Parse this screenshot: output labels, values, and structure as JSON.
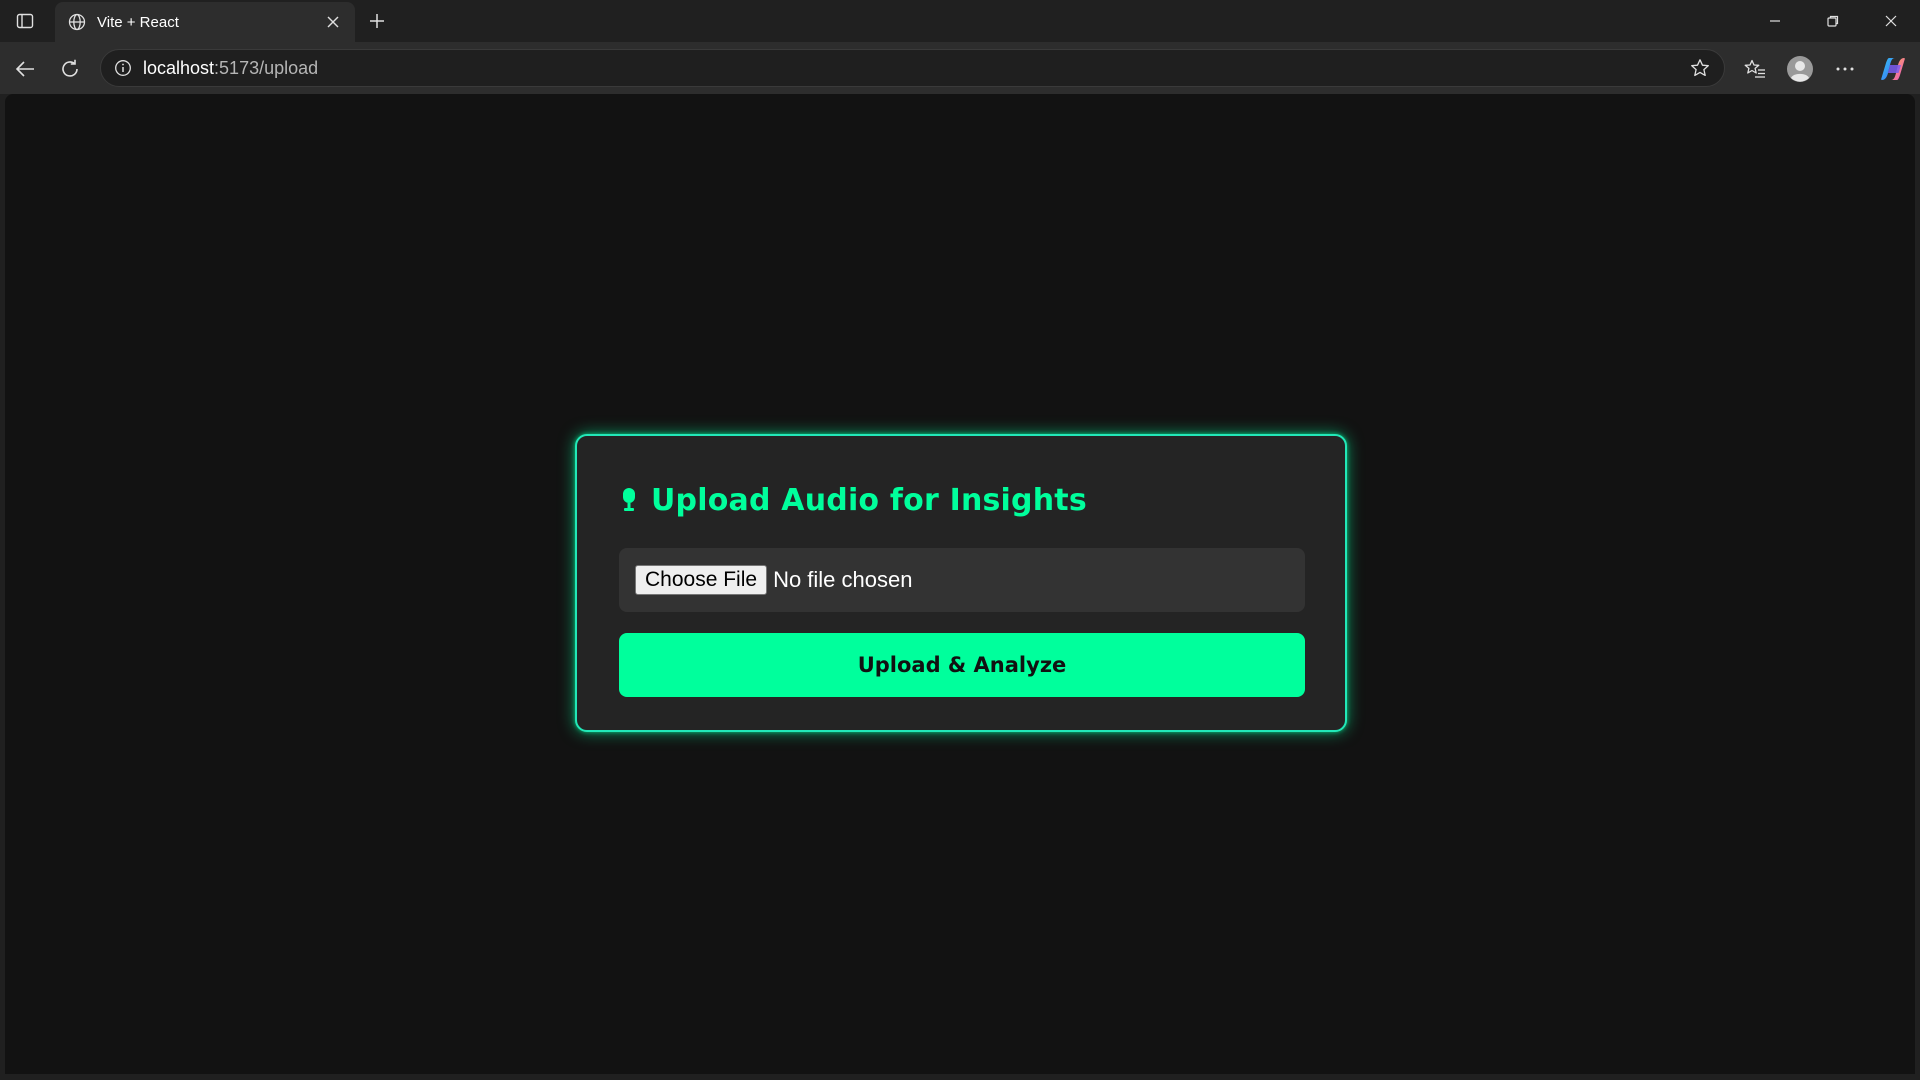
{
  "browser": {
    "tab": {
      "title": "Vite + React"
    },
    "address": {
      "host": "localhost",
      "path": ":5173/upload"
    }
  },
  "colors": {
    "accent": "#00ff9c",
    "card_border": "#22e8b8",
    "page_bg": "#121212",
    "card_bg": "#242424"
  },
  "upload_card": {
    "heading_icon": "microphone-icon",
    "heading": "Upload Audio for Insights",
    "file_input": {
      "button_label": "Choose File",
      "status": "No file chosen"
    },
    "submit_label": "Upload & Analyze"
  }
}
